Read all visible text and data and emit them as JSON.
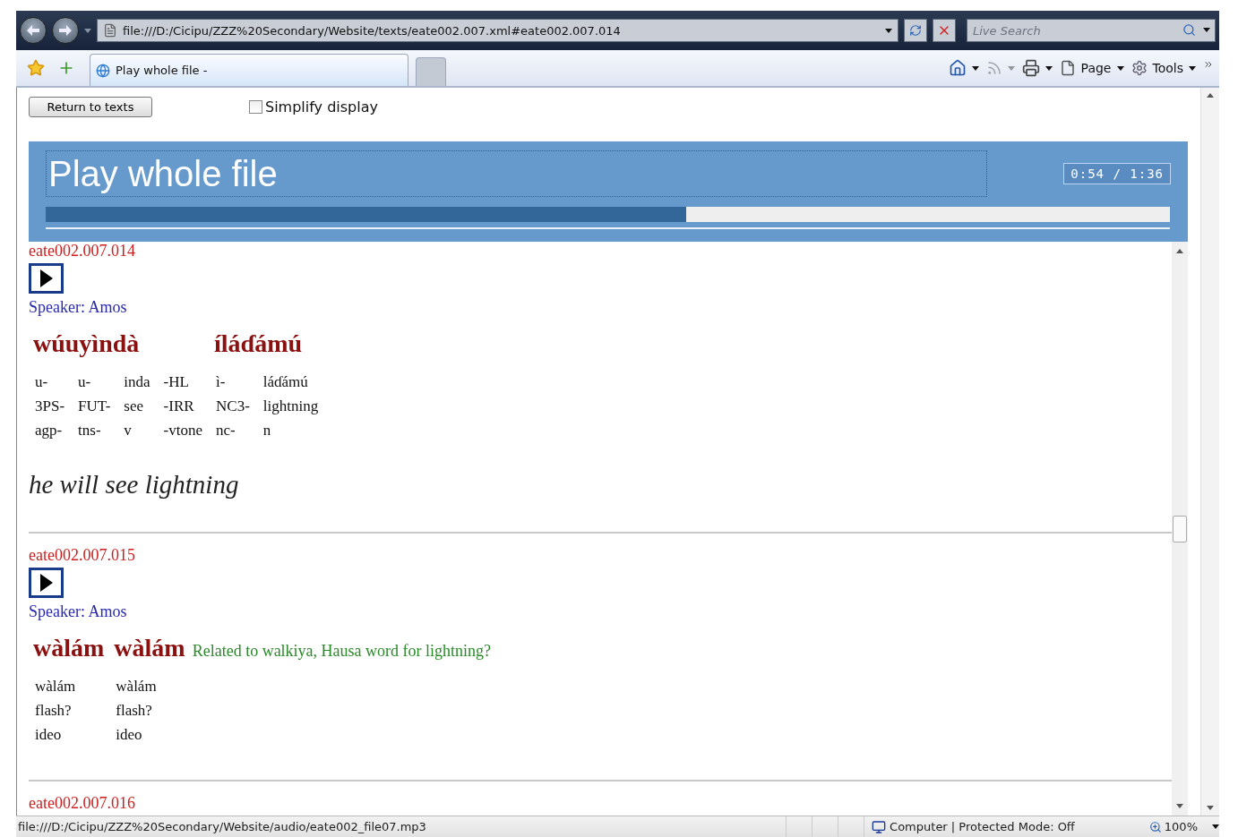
{
  "browser": {
    "address": "file:///D:/Cicipu/ZZZ%20Secondary/Website/texts/eate002.007.xml#eate002.007.014",
    "search": {
      "placeholder": "Live Search"
    },
    "tabs": [
      {
        "label": "Play whole file -",
        "selected": true
      }
    ],
    "commands": [
      {
        "kind": "home",
        "disabled": false
      },
      {
        "kind": "feeds",
        "disabled": true
      },
      {
        "kind": "print",
        "disabled": false
      },
      {
        "kind": "page",
        "label": "Page",
        "disabled": false
      },
      {
        "kind": "tools",
        "label": "Tools",
        "disabled": false
      }
    ]
  },
  "page": {
    "return_button": "Return to texts",
    "simplify": {
      "label": "Simplify display",
      "checked": false
    },
    "player": {
      "title": "Play whole file",
      "time": "0:54 / 1:36",
      "level": 0.57
    },
    "entries": [
      {
        "id": "eate002.007.014",
        "speaker": "Speaker: Amos",
        "words": [
          {
            "form": "wúuyìndà",
            "morphemes": [
              {
                "text": "u-",
                "gloss": "3PS-",
                "pos": "agp-"
              },
              {
                "text": "u-",
                "gloss": "FUT-",
                "pos": "tns-"
              },
              {
                "text": "inda",
                "gloss": "see",
                "pos": "v"
              },
              {
                "text": "-HL",
                "gloss": "-IRR",
                "pos": "-vtone"
              }
            ]
          },
          {
            "form": "íláɗámú",
            "morphemes": [
              {
                "text": "ì-",
                "gloss": "NC3-",
                "pos": "nc-"
              },
              {
                "text": "láɗámú",
                "gloss": "lightning",
                "pos": "n"
              }
            ]
          }
        ],
        "translation": "he will see lightning"
      },
      {
        "id": "eate002.007.015",
        "speaker": "Speaker: Amos",
        "words": [
          {
            "form": "wàlám",
            "morphemes": [
              {
                "text": "wàlám",
                "gloss": "flash?",
                "pos": "ideo"
              }
            ]
          },
          {
            "form": "wàlám",
            "morphemes": [
              {
                "text": "wàlám",
                "gloss": "flash?",
                "pos": "ideo"
              }
            ]
          }
        ],
        "note": "Related to walkiya, Hausa word for lightning?"
      },
      {
        "id": "eate002.007.016"
      }
    ]
  },
  "status": {
    "url": "file:///D:/Cicipu/ZZZ%20Secondary/Website/audio/eate002_file07.mp3",
    "zone": "Computer | Protected Mode: Off",
    "zoom": "100%"
  }
}
